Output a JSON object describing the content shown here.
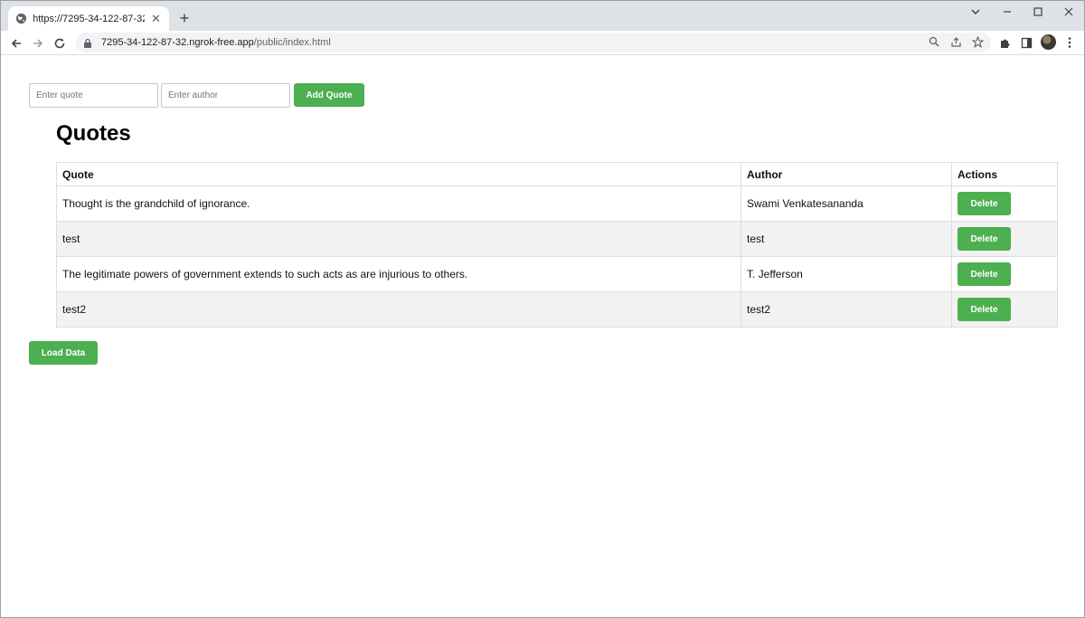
{
  "browser": {
    "tab_title": "https://7295-34-122-87-32.ngrok-free.app/public/index.html",
    "url_host": "7295-34-122-87-32.ngrok-free.app",
    "url_path": "/public/index.html",
    "new_tab_glyph": "+",
    "close_glyph": "✕"
  },
  "form": {
    "quote_placeholder": "Enter quote",
    "author_placeholder": "Enter author",
    "add_label": "Add Quote"
  },
  "page_title": "Quotes",
  "table": {
    "headers": {
      "quote": "Quote",
      "author": "Author",
      "actions": "Actions"
    },
    "rows": [
      {
        "quote": "Thought is the grandchild of ignorance.",
        "author": "Swami Venkatesananda",
        "action": "Delete"
      },
      {
        "quote": "test",
        "author": "test",
        "action": "Delete"
      },
      {
        "quote": "The legitimate powers of government extends to such acts as are injurious to others.",
        "author": "T. Jefferson",
        "action": "Delete"
      },
      {
        "quote": "test2",
        "author": "test2",
        "action": "Delete"
      }
    ]
  },
  "load_label": "Load Data",
  "colors": {
    "accent": "#4caf50",
    "row_alt": "#f2f2f2",
    "chrome": "#dee1e6"
  }
}
